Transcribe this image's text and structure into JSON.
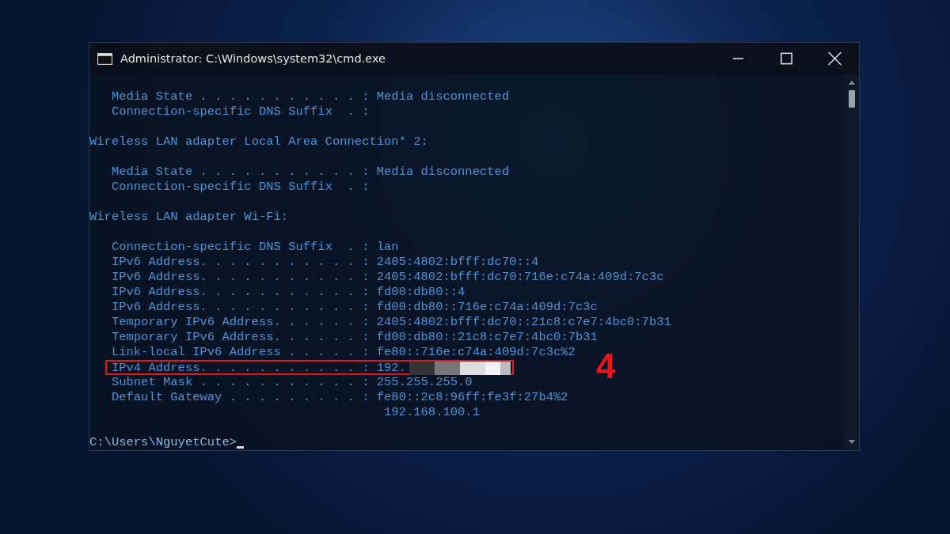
{
  "window": {
    "title": "Administrator: C:\\Windows\\system32\\cmd.exe"
  },
  "console": {
    "lines": [
      {
        "kind": "blank"
      },
      {
        "kind": "entry",
        "label": "Media State . . . . . . . . . . . :",
        "value": "Media disconnected"
      },
      {
        "kind": "entry",
        "label": "Connection-specific DNS Suffix  . :"
      },
      {
        "kind": "blank"
      },
      {
        "kind": "heading",
        "text": "Wireless LAN adapter Local Area Connection* 2:"
      },
      {
        "kind": "blank"
      },
      {
        "kind": "entry",
        "label": "Media State . . . . . . . . . . . :",
        "value": "Media disconnected"
      },
      {
        "kind": "entry",
        "label": "Connection-specific DNS Suffix  . :"
      },
      {
        "kind": "blank"
      },
      {
        "kind": "heading",
        "text": "Wireless LAN adapter Wi-Fi:"
      },
      {
        "kind": "blank"
      },
      {
        "kind": "entry",
        "label": "Connection-specific DNS Suffix  . :",
        "value": "lan"
      },
      {
        "kind": "entry",
        "label": "IPv6 Address. . . . . . . . . . . :",
        "value": "2405:4802:bfff:dc70::4"
      },
      {
        "kind": "entry",
        "label": "IPv6 Address. . . . . . . . . . . :",
        "value": "2405:4802:bfff:dc70:716e:c74a:409d:7c3c"
      },
      {
        "kind": "entry",
        "label": "IPv6 Address. . . . . . . . . . . :",
        "value": "fd00:db80::4"
      },
      {
        "kind": "entry",
        "label": "IPv6 Address. . . . . . . . . . . :",
        "value": "fd00:db80::716e:c74a:409d:7c3c"
      },
      {
        "kind": "entry",
        "label": "Temporary IPv6 Address. . . . . . :",
        "value": "2405:4802:bfff:dc70::21c8:c7e7:4bc0:7b31"
      },
      {
        "kind": "entry",
        "label": "Temporary IPv6 Address. . . . . . :",
        "value": "fd00:db80::21c8:c7e7:4bc0:7b31"
      },
      {
        "kind": "entry",
        "label": "Link-local IPv6 Address . . . . . :",
        "value": "fe80::716e:c74a:409d:7c3c%2"
      },
      {
        "kind": "entry",
        "label": "IPv4 Address. . . . . . . . . . . :",
        "value": "192.",
        "redacted": true
      },
      {
        "kind": "entry",
        "label": "Subnet Mask . . . . . . . . . . . :",
        "value": "255.255.255.0"
      },
      {
        "kind": "entry",
        "label": "Default Gateway . . . . . . . . . :",
        "value": "fe80::2c8:96ff:fe3f:27b4%2"
      },
      {
        "kind": "continuation",
        "value": "192.168.100.1"
      },
      {
        "kind": "blank"
      },
      {
        "kind": "prompt",
        "text": "C:\\Users\\NguyetCute>"
      }
    ]
  },
  "annotation": {
    "step_label": "4"
  }
}
